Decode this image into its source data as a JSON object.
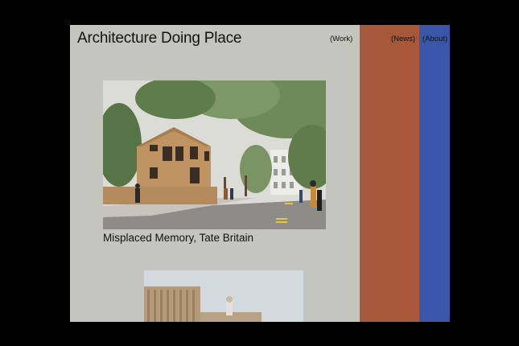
{
  "site": {
    "title": "Architecture Doing Place"
  },
  "nav": {
    "work": "(Work)",
    "news": "(News)",
    "about": "(About)"
  },
  "colors": {
    "work_panel": "#c5c5bf",
    "news_panel": "#a7583a",
    "about_panel": "#3a56ab",
    "page_background": "#000000"
  },
  "projects": [
    {
      "caption": "Misplaced Memory, Tate Britain"
    }
  ]
}
